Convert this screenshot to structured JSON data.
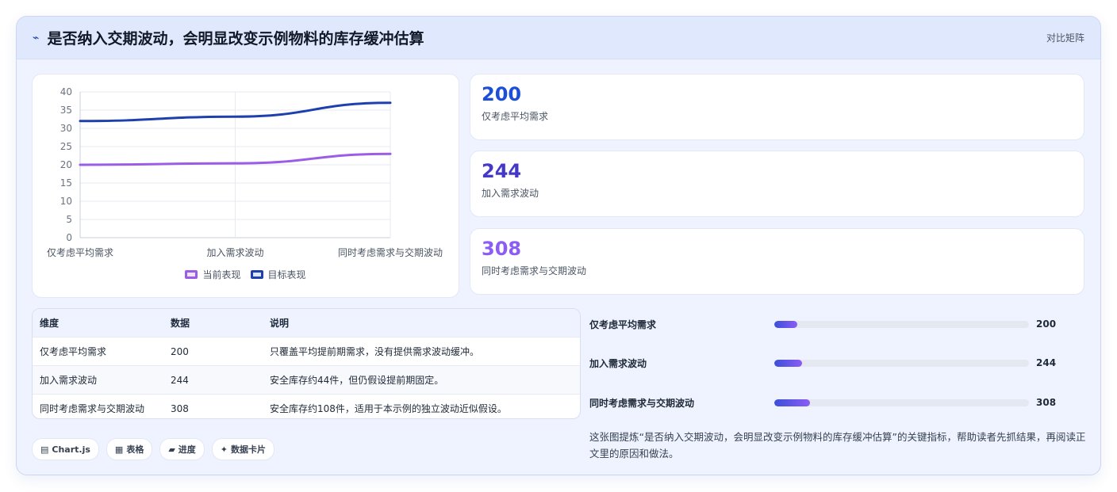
{
  "header": {
    "icon": "chart-line-icon",
    "title": "是否纳入交期波动，会明显改变示例物料的库存缓冲估算",
    "right_label": "对比矩阵"
  },
  "chart_data": {
    "type": "line",
    "categories": [
      "仅考虑平均需求",
      "加入需求波动",
      "同时考虑需求与交期波动"
    ],
    "series": [
      {
        "name": "当前表现",
        "values": [
          20,
          20.4,
          23
        ],
        "color": "#9b5de5"
      },
      {
        "name": "目标表现",
        "values": [
          32,
          33.2,
          37
        ],
        "color": "#1e40af"
      }
    ],
    "ylim": [
      0,
      40
    ],
    "yticks": [
      0,
      5,
      10,
      15,
      20,
      25,
      30,
      35,
      40
    ],
    "grid": true,
    "legend": "bottom"
  },
  "kpis": [
    {
      "value": "200",
      "label": "仅考虑平均需求",
      "color": "#1d4ed8"
    },
    {
      "value": "244",
      "label": "加入需求波动",
      "color": "#4338ca"
    },
    {
      "value": "308",
      "label": "同时考虑需求与交期波动",
      "color": "#8b5cf6"
    }
  ],
  "table": {
    "headers": [
      "维度",
      "数据",
      "说明"
    ],
    "rows": [
      [
        "仅考虑平均需求",
        "200",
        "只覆盖平均提前期需求，没有提供需求波动缓冲。"
      ],
      [
        "加入需求波动",
        "244",
        "安全库存约44件，但仍假设提前期固定。"
      ],
      [
        "同时考虑需求与交期波动",
        "308",
        "安全库存约108件，适用于本示例的独立波动近似假设。"
      ]
    ]
  },
  "tags": [
    {
      "icon": "chart-icon",
      "glyph": "▤",
      "label": "Chart.js"
    },
    {
      "icon": "table-icon",
      "glyph": "▦",
      "label": "表格"
    },
    {
      "icon": "progress-icon",
      "glyph": "▰",
      "label": "进度"
    },
    {
      "icon": "sparkle-icon",
      "glyph": "✦",
      "label": "数据卡片"
    }
  ],
  "progress": [
    {
      "label": "仅考虑平均需求",
      "value": "200",
      "fraction": 0.09
    },
    {
      "label": "加入需求波动",
      "value": "244",
      "fraction": 0.11
    },
    {
      "label": "同时考虑需求与交期波动",
      "value": "308",
      "fraction": 0.14
    }
  ],
  "note": "这张图提炼“是否纳入交期波动，会明显改变示例物料的库存缓冲估算”的关键指标，帮助读者先抓结果，再阅读正文里的原因和做法。"
}
